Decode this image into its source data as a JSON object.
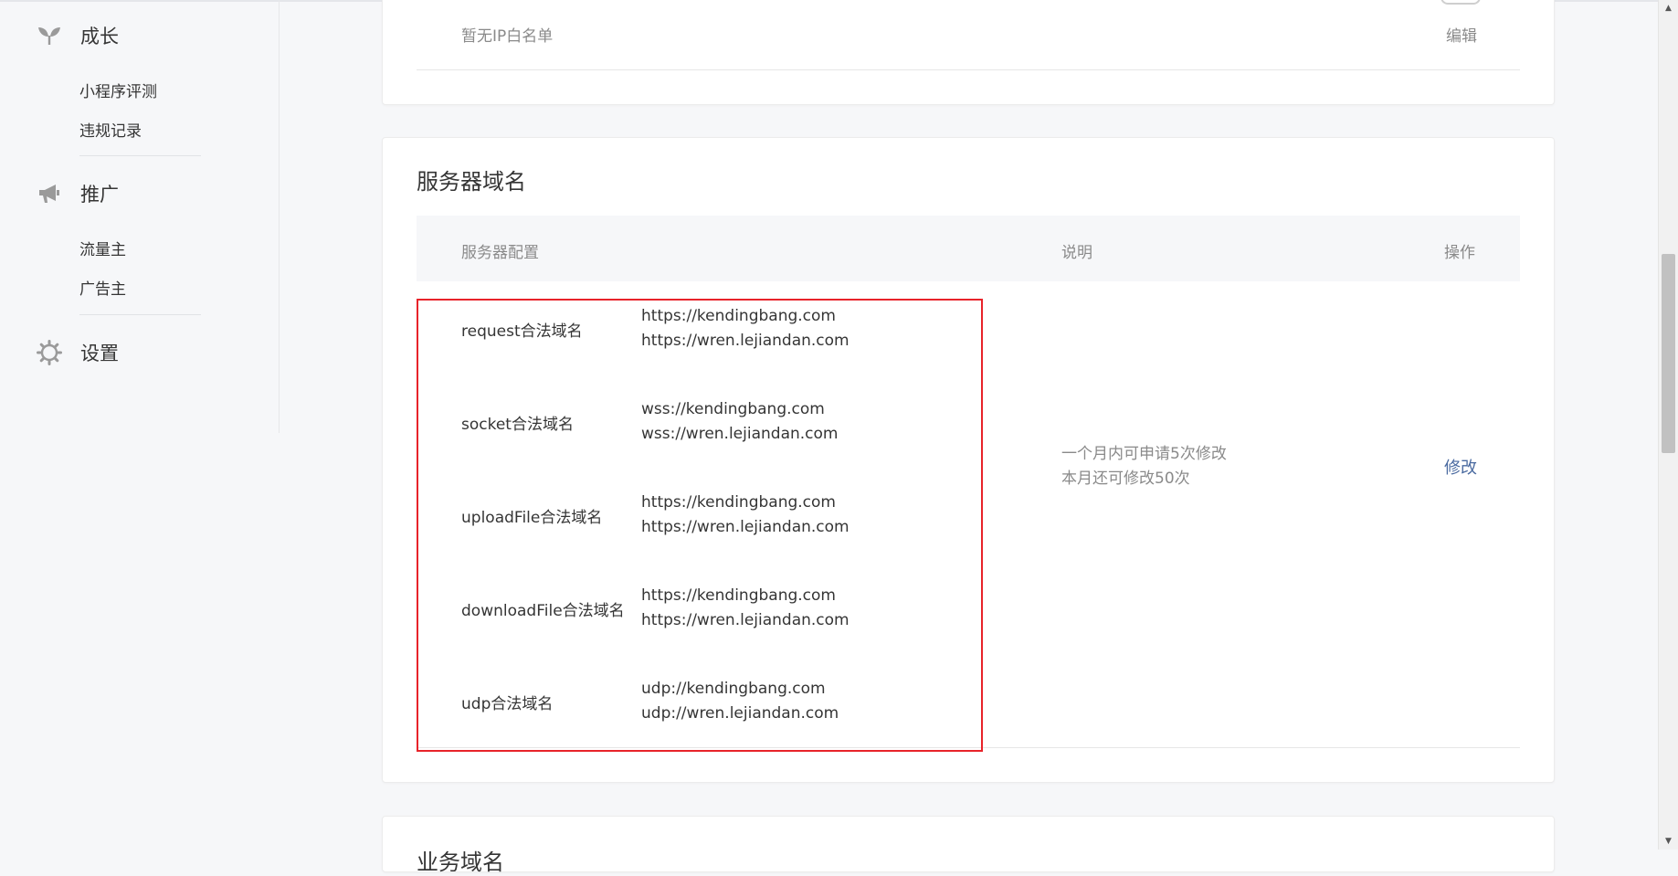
{
  "sidebar": {
    "groups": [
      {
        "label": "成长",
        "icon": "sprout-icon",
        "items": [
          "小程序评测",
          "违规记录"
        ]
      },
      {
        "label": "推广",
        "icon": "megaphone-icon",
        "items": [
          "流量主",
          "广告主"
        ]
      },
      {
        "label": "设置",
        "icon": "gear-icon",
        "items": []
      }
    ]
  },
  "ip_whitelist": {
    "empty_text": "暂无IP白名单",
    "edit_label": "编辑"
  },
  "server_domain": {
    "title": "服务器域名",
    "columns": {
      "config": "服务器配置",
      "desc": "说明",
      "op": "操作"
    },
    "rows": [
      {
        "label": "request合法域名",
        "values": [
          "https://kendingbang.com",
          "https://wren.lejiandan.com"
        ]
      },
      {
        "label": "socket合法域名",
        "values": [
          "wss://kendingbang.com",
          "wss://wren.lejiandan.com"
        ]
      },
      {
        "label": "uploadFile合法域名",
        "values": [
          "https://kendingbang.com",
          "https://wren.lejiandan.com"
        ]
      },
      {
        "label": "downloadFile合法域名",
        "values": [
          "https://kendingbang.com",
          "https://wren.lejiandan.com"
        ]
      },
      {
        "label": "udp合法域名",
        "values": [
          "udp://kendingbang.com",
          "udp://wren.lejiandan.com"
        ]
      }
    ],
    "desc_lines": [
      "一个月内可申请5次修改",
      "本月还可修改50次"
    ],
    "modify_label": "修改"
  },
  "business_domain": {
    "title": "业务域名"
  },
  "colors": {
    "link": "#4a6aa0",
    "highlight": "#e8232a",
    "muted": "#8a8a8a"
  }
}
